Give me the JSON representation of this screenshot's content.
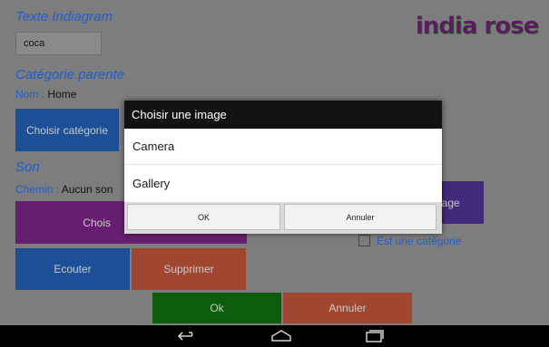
{
  "form": {
    "text_heading": "Texte Indiagram",
    "text_value": "coca",
    "category_heading": "Catégorie parente",
    "category_name_label": "Nom :",
    "category_name_value": "Home",
    "choose_category_label": "Choisir catégorie",
    "sound_heading": "Son",
    "path_label": "Chemin :",
    "path_value": "Aucun son",
    "choose_sound_partial": "Chois",
    "image_partial": "nage",
    "is_category_label": "Est une catégorie",
    "listen_label": "Ecouter",
    "delete_label": "Supprimer",
    "ok_label": "Ok",
    "cancel_label": "Annuler"
  },
  "logo": {
    "text": "india rose"
  },
  "dialog": {
    "title": "Choisir une image",
    "options": [
      "Camera",
      "Gallery"
    ],
    "ok": "OK",
    "cancel": "Annuler"
  },
  "colors": {
    "accent_blue": "#1e5fcf",
    "purple": "#7a1e86",
    "orange": "#a04631",
    "green": "#0d5c0d",
    "deep_purple": "#3f2b7a",
    "logo_purple": "#6b1f6f"
  },
  "nav_icons": [
    "back-icon",
    "home-icon",
    "recents-icon"
  ]
}
